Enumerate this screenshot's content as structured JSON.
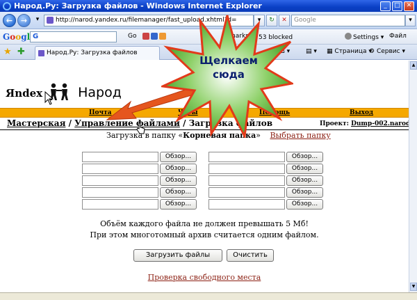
{
  "window": {
    "title": "Народ.Ру: Загрузка файлов - Windows Internet Explorer",
    "minimize": "_",
    "maximize": "□",
    "close": "✕"
  },
  "address_bar": {
    "url": "http://narod.yandex.ru/filemanager/fast_upload.xhtml?d=",
    "search_placeholder": "Google",
    "refresh": "↻",
    "stop": "✕",
    "dropdown": "▾",
    "search_go": "▾"
  },
  "google_toolbar": {
    "logo": "Google",
    "search_value": "G",
    "go": "Go",
    "bookmarks": "marks",
    "popups": "53 blocked",
    "settings": "Settings",
    "file": "Файл"
  },
  "tab_bar": {
    "tab_title": "Народ.Ру: Загрузка файлов",
    "page_menu": "Страница",
    "tools_menu": "Сервис"
  },
  "site": {
    "logo_yandex": "Яndex",
    "logo_narod": "Народ",
    "menu": [
      "Почта",
      "Чаты",
      "Помощь",
      "Выход"
    ],
    "breadcrumb": {
      "master": "Мастерская",
      "sep": " / ",
      "file_management": "Управление файлами",
      "current": "Загрузка файлов"
    },
    "project_label": "Проект:",
    "project_name": "Dump-002.narod.ru",
    "upload_prefix": "Загрузка в папку «",
    "folder_name": "Корневая папка",
    "upload_suffix": "»",
    "choose_folder": "Выбрать папку",
    "browse_label": "Обзор...",
    "note_line1": "Объём каждого файла не должен превышать 5 Мб!",
    "note_line2": "При этом многотомный архив считается одним файлом.",
    "upload_button": "Загрузить файлы",
    "clear_button": "Очистить",
    "check_space": "Проверка свободного места"
  },
  "annotation": {
    "line1": "Щелкаем",
    "line2": "сюда",
    "burst_color": "#4da52a",
    "burst_edge": "#e23a1a",
    "arrow_color": "#e5561e"
  }
}
